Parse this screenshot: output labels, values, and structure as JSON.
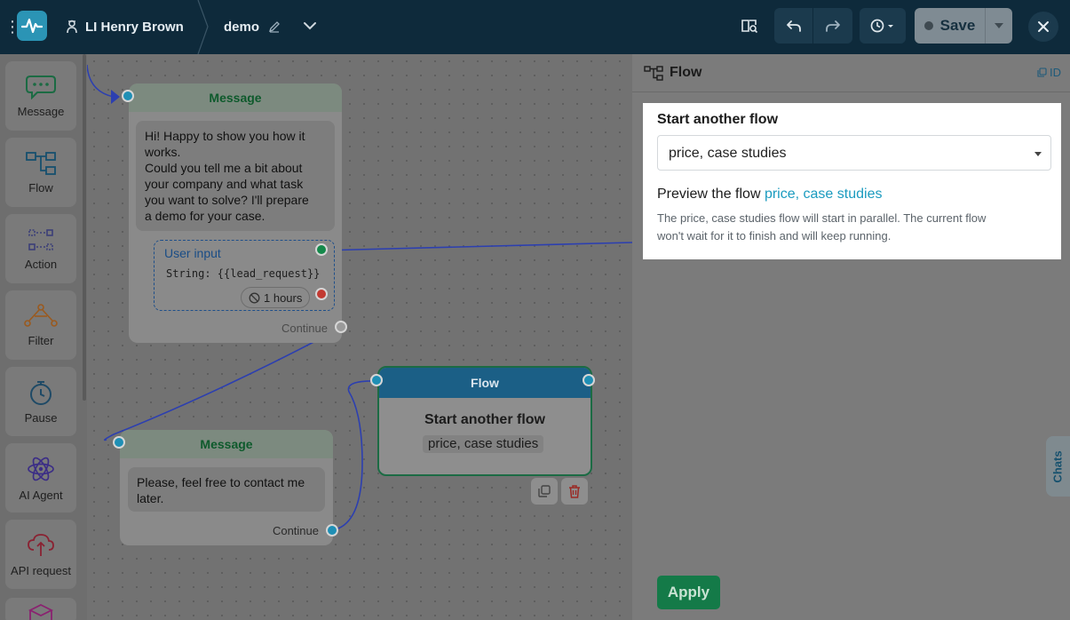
{
  "topbar": {
    "user_name": "LI Henry Brown",
    "project_name": "demo",
    "save_label": "Save",
    "icons": [
      "menu-dots-icon",
      "pulse-logo-icon",
      "user-icon",
      "pencil-icon",
      "chevron-down-icon",
      "book-icon",
      "undo-icon",
      "redo-icon",
      "history-icon",
      "close-icon"
    ]
  },
  "sidebar": {
    "items": [
      {
        "label": "Message",
        "icon": "chat-icon"
      },
      {
        "label": "Flow",
        "icon": "flow-icon"
      },
      {
        "label": "Action",
        "icon": "action-icon"
      },
      {
        "label": "Filter",
        "icon": "filter-icon"
      },
      {
        "label": "Pause",
        "icon": "stopwatch-icon"
      },
      {
        "label": "AI Agent",
        "icon": "atom-icon"
      },
      {
        "label": "API request",
        "icon": "cloud-icon"
      }
    ]
  },
  "canvas": {
    "message_node_1": {
      "title": "Message",
      "text_lines": [
        "Hi! Happy to show you how it",
        "works.",
        "Could you tell me a bit about",
        "your company and what task",
        "you want to solve? I'll prepare",
        "a demo for your case."
      ],
      "user_input_label": "User input",
      "user_input_var": "String: {{lead_request}}",
      "timeout": "1 hours",
      "continue_label": "Continue"
    },
    "message_node_2": {
      "title": "Message",
      "text_lines": [
        "Please, feel free to contact me",
        "later."
      ],
      "continue_label": "Continue"
    },
    "flow_node": {
      "title": "Flow",
      "heading": "Start another flow",
      "flow_name": "price, case studies"
    }
  },
  "panel": {
    "title": "Flow",
    "id_label": "ID",
    "field_label": "Start another flow",
    "selected_flow": "price, case studies",
    "preview_prefix": "Preview the flow",
    "preview_link": "price, case studies",
    "description_line1": "The price, case studies flow will start in parallel. The current flow",
    "description_line2": "won't wait for it to finish and will keep running.",
    "apply_label": "Apply",
    "chats_label": "Chats"
  },
  "colors": {
    "topbar_bg": "#0e2a3b",
    "accent_blue": "#1b9bbf",
    "apply_green": "#147a48",
    "message_green": "#0e5a2c",
    "flow_header": "#1b5f86"
  }
}
